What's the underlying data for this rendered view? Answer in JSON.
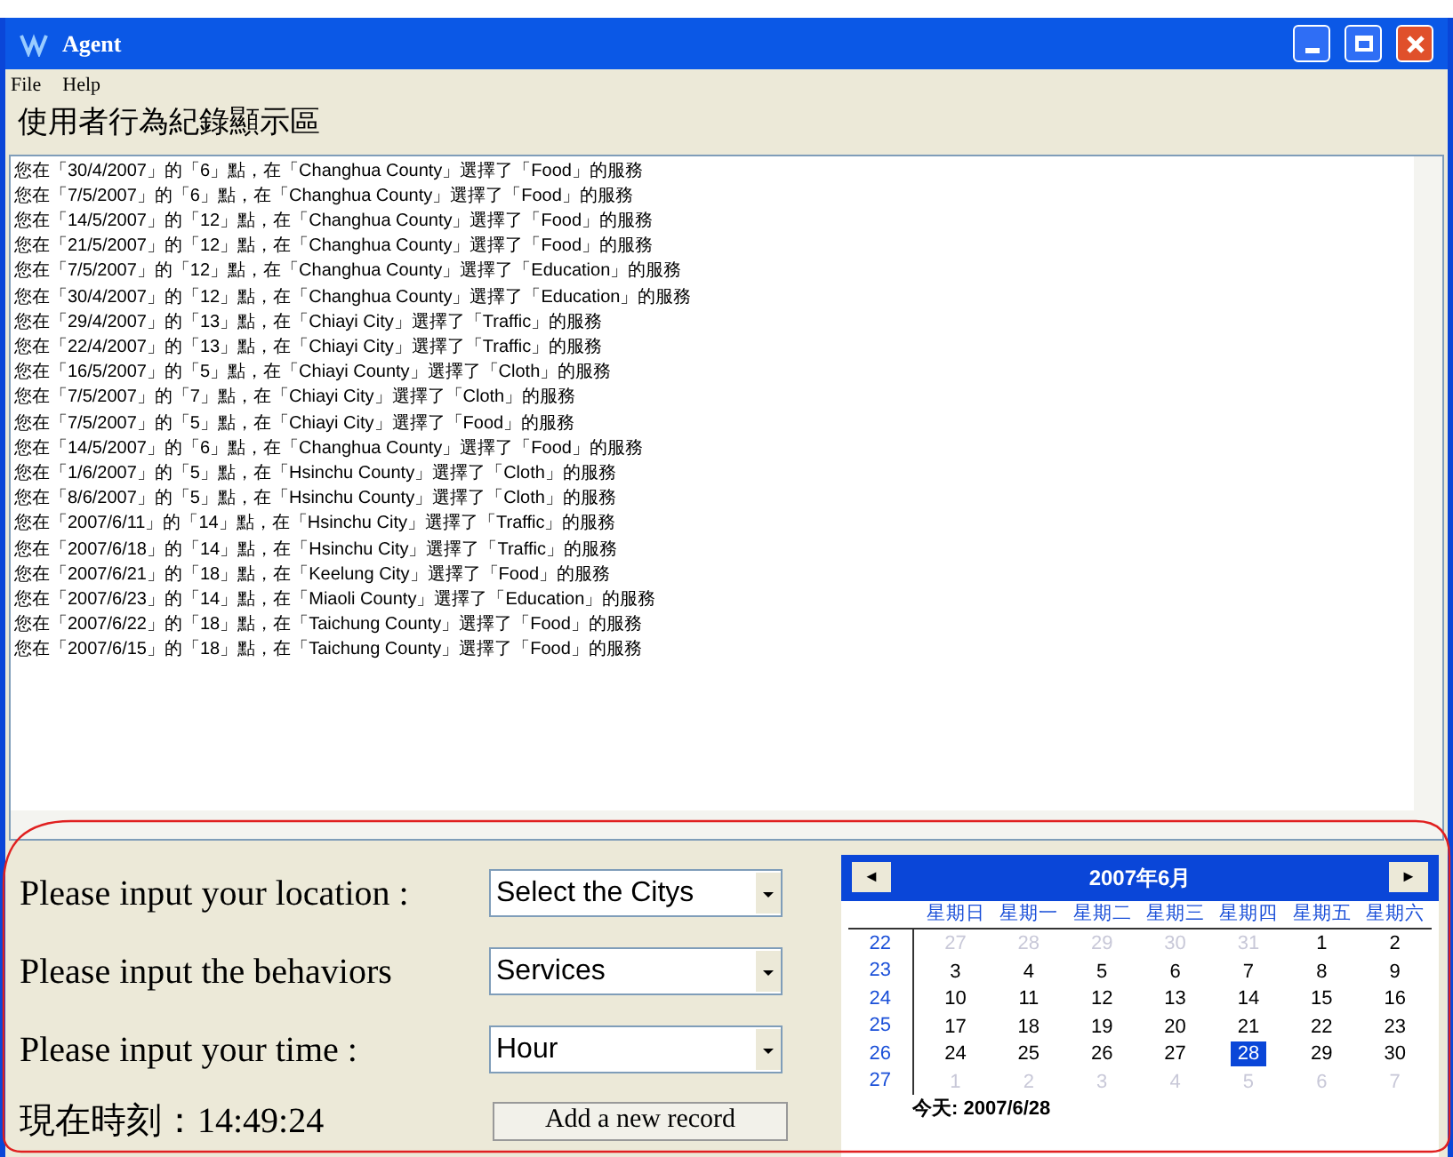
{
  "window": {
    "title": "Agent"
  },
  "menu": [
    "File",
    "Help"
  ],
  "heading": "使用者行為紀錄顯示區",
  "log_lines": [
    "您在「30/4/2007」的「6」點，在「Changhua County」選擇了「Food」的服務",
    "您在「7/5/2007」的「6」點，在「Changhua County」選擇了「Food」的服務",
    "您在「14/5/2007」的「12」點，在「Changhua County」選擇了「Food」的服務",
    "您在「21/5/2007」的「12」點，在「Changhua County」選擇了「Food」的服務",
    "您在「7/5/2007」的「12」點，在「Changhua County」選擇了「Education」的服務",
    "您在「30/4/2007」的「12」點，在「Changhua County」選擇了「Education」的服務",
    "您在「29/4/2007」的「13」點，在「Chiayi City」選擇了「Traffic」的服務",
    "您在「22/4/2007」的「13」點，在「Chiayi City」選擇了「Traffic」的服務",
    "您在「16/5/2007」的「5」點，在「Chiayi County」選擇了「Cloth」的服務",
    "您在「7/5/2007」的「7」點，在「Chiayi City」選擇了「Cloth」的服務",
    "您在「7/5/2007」的「5」點，在「Chiayi City」選擇了「Food」的服務",
    "您在「14/5/2007」的「6」點，在「Changhua County」選擇了「Food」的服務",
    "您在「1/6/2007」的「5」點，在「Hsinchu County」選擇了「Cloth」的服務",
    "您在「8/6/2007」的「5」點，在「Hsinchu County」選擇了「Cloth」的服務",
    "您在「2007/6/11」的「14」點，在「Hsinchu City」選擇了「Traffic」的服務",
    "您在「2007/6/18」的「14」點，在「Hsinchu City」選擇了「Traffic」的服務",
    "您在「2007/6/21」的「18」點，在「Keelung City」選擇了「Food」的服務",
    "您在「2007/6/23」的「14」點，在「Miaoli County」選擇了「Education」的服務",
    "您在「2007/6/22」的「18」點，在「Taichung County」選擇了「Food」的服務",
    "您在「2007/6/15」的「18」點，在「Taichung County」選擇了「Food」的服務"
  ],
  "form": [
    {
      "label": "Please input your location :",
      "value": "Select the Citys"
    },
    {
      "label": "Please input the behaviors",
      "value": "Services"
    },
    {
      "label": "Please input your time :",
      "value": "Hour"
    }
  ],
  "clock": "現在時刻：14:49:24",
  "add_button": "Add a new record",
  "calendar": {
    "prev": "◄",
    "next": "►",
    "title": "2007年6月",
    "weekdays": [
      "星期日",
      "星期一",
      "星期二",
      "星期三",
      "星期四",
      "星期五",
      "星期六"
    ],
    "weeks": [
      {
        "number": "22",
        "days": [
          {
            "text": "27",
            "muted": true,
            "selected": false
          },
          {
            "text": "28",
            "muted": true,
            "selected": false
          },
          {
            "text": "29",
            "muted": true,
            "selected": false
          },
          {
            "text": "30",
            "muted": true,
            "selected": false
          },
          {
            "text": "31",
            "muted": true,
            "selected": false
          },
          {
            "text": "1",
            "muted": false,
            "selected": false
          },
          {
            "text": "2",
            "muted": false,
            "selected": false
          }
        ]
      },
      {
        "number": "23",
        "days": [
          {
            "text": "3",
            "muted": false,
            "selected": false
          },
          {
            "text": "4",
            "muted": false,
            "selected": false
          },
          {
            "text": "5",
            "muted": false,
            "selected": false
          },
          {
            "text": "6",
            "muted": false,
            "selected": false
          },
          {
            "text": "7",
            "muted": false,
            "selected": false
          },
          {
            "text": "8",
            "muted": false,
            "selected": false
          },
          {
            "text": "9",
            "muted": false,
            "selected": false
          }
        ]
      },
      {
        "number": "24",
        "days": [
          {
            "text": "10",
            "muted": false,
            "selected": false
          },
          {
            "text": "11",
            "muted": false,
            "selected": false
          },
          {
            "text": "12",
            "muted": false,
            "selected": false
          },
          {
            "text": "13",
            "muted": false,
            "selected": false
          },
          {
            "text": "14",
            "muted": false,
            "selected": false
          },
          {
            "text": "15",
            "muted": false,
            "selected": false
          },
          {
            "text": "16",
            "muted": false,
            "selected": false
          }
        ]
      },
      {
        "number": "25",
        "days": [
          {
            "text": "17",
            "muted": false,
            "selected": false
          },
          {
            "text": "18",
            "muted": false,
            "selected": false
          },
          {
            "text": "19",
            "muted": false,
            "selected": false
          },
          {
            "text": "20",
            "muted": false,
            "selected": false
          },
          {
            "text": "21",
            "muted": false,
            "selected": false
          },
          {
            "text": "22",
            "muted": false,
            "selected": false
          },
          {
            "text": "23",
            "muted": false,
            "selected": false
          }
        ]
      },
      {
        "number": "26",
        "days": [
          {
            "text": "24",
            "muted": false,
            "selected": false
          },
          {
            "text": "25",
            "muted": false,
            "selected": false
          },
          {
            "text": "26",
            "muted": false,
            "selected": false
          },
          {
            "text": "27",
            "muted": false,
            "selected": false
          },
          {
            "text": "28",
            "muted": false,
            "selected": true
          },
          {
            "text": "29",
            "muted": false,
            "selected": false
          },
          {
            "text": "30",
            "muted": false,
            "selected": false
          }
        ]
      },
      {
        "number": "27",
        "days": [
          {
            "text": "1",
            "muted": true,
            "selected": false
          },
          {
            "text": "2",
            "muted": true,
            "selected": false
          },
          {
            "text": "3",
            "muted": true,
            "selected": false
          },
          {
            "text": "4",
            "muted": true,
            "selected": false
          },
          {
            "text": "5",
            "muted": true,
            "selected": false
          },
          {
            "text": "6",
            "muted": true,
            "selected": false
          },
          {
            "text": "7",
            "muted": true,
            "selected": false
          }
        ]
      }
    ],
    "today": "今天: 2007/6/28"
  }
}
